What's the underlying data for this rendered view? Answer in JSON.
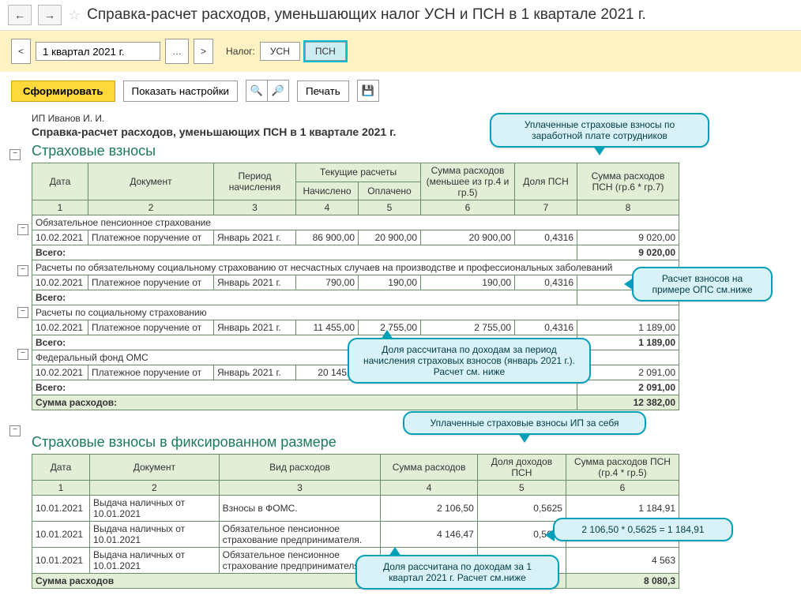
{
  "header": {
    "title": "Справка-расчет расходов, уменьшающих налог УСН и ПСН в 1 квартале 2021 г."
  },
  "period": {
    "value": "1 квартал 2021 г.",
    "prev": "<",
    "next": ">",
    "tax_label": "Налог:",
    "usn": "УСН",
    "psn": "ПСН"
  },
  "toolbar": {
    "form": "Сформировать",
    "settings": "Показать настройки",
    "print": "Печать"
  },
  "report": {
    "owner": "ИП Иванов И. И.",
    "title": "Справка-расчет расходов, уменьшающих ПСН в 1 квартале 2021 г.",
    "section1": {
      "title": "Страховые взносы",
      "headers": {
        "c1": "Дата",
        "c2": "Документ",
        "c3": "Период начисления",
        "c4": "Текущие расчеты",
        "c4a": "Начислено",
        "c4b": "Оплачено",
        "c5": "Сумма расходов (меньшее из гр.4 и гр.5)",
        "c6": "Доля ПСН",
        "c7": "Сумма расходов ПСН (гр.6 * гр.7)"
      },
      "nums": {
        "n1": "1",
        "n2": "2",
        "n3": "3",
        "n4": "4",
        "n5": "5",
        "n6": "6",
        "n7": "7",
        "n8": "8"
      },
      "groups": [
        {
          "name": "Обязательное пенсионное страхование",
          "rows": [
            {
              "date": "10.02.2021",
              "doc": "Платежное поручение от",
              "period": "Январь 2021 г.",
              "accr": "86 900,00",
              "paid": "20 900,00",
              "min": "20 900,00",
              "share": "0,4316",
              "psn": "9 020,00"
            }
          ],
          "total": {
            "label": "Всего:",
            "psn": "9 020,00"
          }
        },
        {
          "name": "Расчеты по обязательному социальному страхованию от несчастных случаев на производстве и профессиональных заболеваний",
          "rows": [
            {
              "date": "10.02.2021",
              "doc": "Платежное поручение от",
              "period": "Январь 2021 г.",
              "accr": "790,00",
              "paid": "190,00",
              "min": "190,00",
              "share": "0,4316",
              "psn": ""
            }
          ],
          "total": {
            "label": "Всего:",
            "psn": ""
          }
        },
        {
          "name": "Расчеты по социальному страхованию",
          "rows": [
            {
              "date": "10.02.2021",
              "doc": "Платежное поручение от",
              "period": "Январь 2021 г.",
              "accr": "11 455,00",
              "paid": "2 755,00",
              "min": "2 755,00",
              "share": "0,4316",
              "psn": "1 189,00"
            }
          ],
          "total": {
            "label": "Всего:",
            "psn": "1 189,00"
          }
        },
        {
          "name": "Федеральный фонд ОМС",
          "rows": [
            {
              "date": "10.02.2021",
              "doc": "Платежное поручение от",
              "period": "Январь 2021 г.",
              "accr": "20 145,0",
              "paid": "",
              "min": "",
              "share": "",
              "psn": "2 091,00"
            }
          ],
          "total": {
            "label": "Всего:",
            "psn": "2 091,00"
          }
        }
      ],
      "grand": {
        "label": "Сумма расходов:",
        "psn": "12 382,00"
      }
    },
    "section2": {
      "title": "Страховые взносы в фиксированном размере",
      "headers": {
        "c1": "Дата",
        "c2": "Документ",
        "c3": "Вид расходов",
        "c4": "Сумма расходов",
        "c5": "Доля доходов ПСН",
        "c6": "Сумма расходов ПСН (гр.4 * гр.5)"
      },
      "nums": {
        "n1": "1",
        "n2": "2",
        "n3": "3",
        "n4": "4",
        "n5": "5",
        "n6": "6"
      },
      "rows": [
        {
          "date": "10.01.2021",
          "doc": "Выдача наличных  от 10.01.2021",
          "type": "Взносы в ФОМС.",
          "sum": "2 106,50",
          "share": "0,5625",
          "psn": "1 184,91"
        },
        {
          "date": "10.01.2021",
          "doc": "Выдача наличных  от 10.01.2021",
          "type": "Обязательное пенсионное страхование предпринимателя.",
          "sum": "4 146,47",
          "share": "0,5625",
          "psn": ""
        },
        {
          "date": "10.01.2021",
          "doc": "Выдача наличных  от 10.01.2021",
          "type": "Обязательное пенсионное страхование предпринимателя.",
          "sum": "",
          "share": "",
          "psn": "4 563"
        }
      ],
      "grand": {
        "label": "Сумма расходов",
        "psn": "8 080,3"
      }
    }
  },
  "callouts": {
    "c1": "Уплаченные страховые взносы по заработной плате сотрудников",
    "c2": "Расчет взносов на примере ОПС см.ниже",
    "c3": "Доля рассчитана по доходам за период начисления страховых взносов (январь 2021 г.). Расчет см. ниже",
    "c4": "Уплаченные страховые взносы ИП за себя",
    "c5": "2 106,50 * 0,5625 = 1 184,91",
    "c6": "Доля рассчитана по доходам за 1 квартал 2021 г. Расчет см.ниже"
  }
}
